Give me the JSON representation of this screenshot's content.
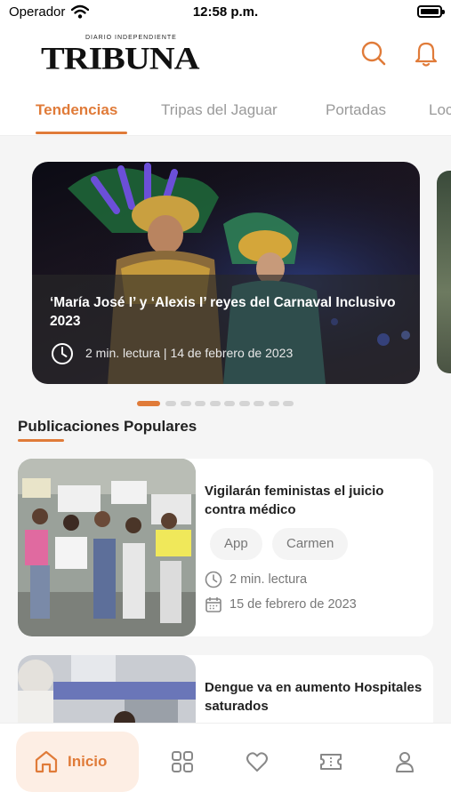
{
  "status_bar": {
    "carrier": "Operador",
    "time": "12:58 p.m."
  },
  "header": {
    "logo_small": "DIARIO INDEPENDIENTE",
    "logo_main": "TRIBUNA",
    "icons": [
      "search-icon",
      "bell-icon"
    ]
  },
  "tabs": [
    {
      "label": "Tendencias",
      "active": true
    },
    {
      "label": "Tripas del Jaguar",
      "active": false
    },
    {
      "label": "Portadas",
      "active": false
    },
    {
      "label": "Loc",
      "active": false
    }
  ],
  "hero": {
    "title": "‘María José I’ y ‘Alexis I’ reyes del Carnaval Inclusivo 2023",
    "meta": "2  min. lectura | 14 de febrero de 2023",
    "icon": "clock-icon"
  },
  "carousel": {
    "total": 10,
    "active_index": 0
  },
  "section": {
    "title": "Publicaciones Populares"
  },
  "articles": [
    {
      "title": "Vigilarán feministas el juicio contra médico",
      "tags": [
        "App",
        "Carmen"
      ],
      "read_time": "2 min. lectura",
      "date": "15 de febrero de 2023"
    },
    {
      "title": "Dengue va en aumento Hospitales saturados"
    }
  ],
  "bottom_nav": {
    "home_label": "Inicio",
    "items": [
      "home-icon",
      "grid-icon",
      "heart-icon",
      "ticket-icon",
      "user-icon"
    ]
  },
  "colors": {
    "accent": "#e07b39",
    "background": "#f5f5f5",
    "text": "#222222"
  }
}
